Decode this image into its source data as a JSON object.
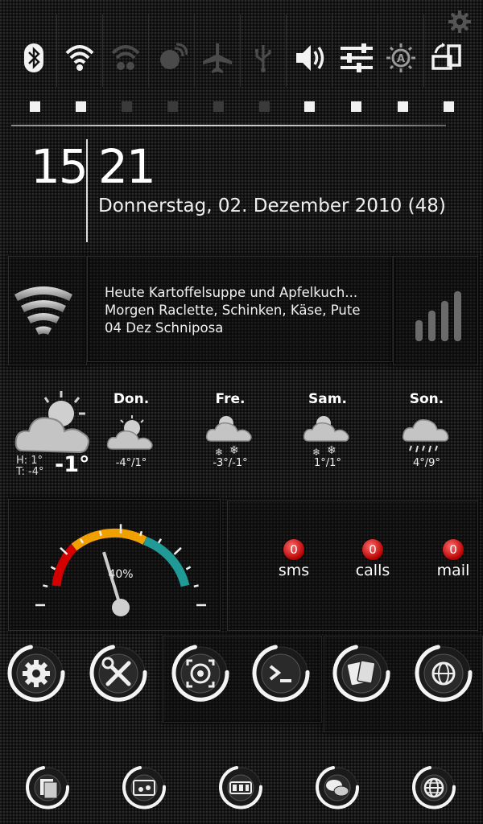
{
  "toggles": [
    {
      "name": "bluetooth",
      "icon": "bluetooth-icon",
      "on": true
    },
    {
      "name": "wifi",
      "icon": "wifi-icon",
      "on": true
    },
    {
      "name": "data",
      "icon": "mobile-data-icon",
      "on": false
    },
    {
      "name": "gps",
      "icon": "satellite-icon",
      "on": false
    },
    {
      "name": "airplane",
      "icon": "airplane-icon",
      "on": false
    },
    {
      "name": "usb",
      "icon": "usb-icon",
      "on": false
    },
    {
      "name": "sound",
      "icon": "volume-icon",
      "on": true
    },
    {
      "name": "settings",
      "icon": "sliders-icon",
      "on": true
    },
    {
      "name": "brightness",
      "icon": "brightness-auto-icon",
      "on": true
    },
    {
      "name": "rotate",
      "icon": "screen-rotate-icon",
      "on": true
    }
  ],
  "clock": {
    "hour": "15",
    "minute": "21",
    "date": "Donnerstag, 02. Dezember 2010 (48)"
  },
  "menu": {
    "lines": [
      "Heute Kartoffelsuppe und Apfelkuch...",
      "Morgen Raclette, Schinken, Käse, Pute",
      "04 Dez Schniposa"
    ]
  },
  "weather": {
    "today": {
      "hl": "H: 1°",
      "t": "T: -4°",
      "current": "-1°",
      "icon": "sun-cloud-icon"
    },
    "days": [
      {
        "name": "Don.",
        "temp": "-4°/1°",
        "icon": "partly-cloudy-icon"
      },
      {
        "name": "Fre.",
        "temp": "-3°/-1°",
        "icon": "snow-sun-icon"
      },
      {
        "name": "Sam.",
        "temp": "1°/1°",
        "icon": "snow-sun-icon"
      },
      {
        "name": "Son.",
        "temp": "4°/9°",
        "icon": "rain-icon"
      }
    ]
  },
  "battery": {
    "percent_label": "40%",
    "level": 0.4
  },
  "counters": [
    {
      "label": "sms",
      "count": "0"
    },
    {
      "label": "calls",
      "count": "0"
    },
    {
      "label": "mail",
      "count": "0"
    }
  ],
  "apps_row1": [
    {
      "icon": "settings-gear-icon"
    },
    {
      "icon": "tools-icon"
    },
    {
      "icon": "camera-icon"
    },
    {
      "icon": "terminal-icon"
    },
    {
      "icon": "cards-icon"
    },
    {
      "icon": "globe-icon"
    }
  ],
  "apps_row2": [
    {
      "icon": "files-icon"
    },
    {
      "icon": "music-icon"
    },
    {
      "icon": "calculator-icon"
    },
    {
      "icon": "chat-icon"
    },
    {
      "icon": "browser-globe-icon"
    }
  ],
  "colors": {
    "accent_red": "#d40000",
    "accent_orange": "#f0a000",
    "accent_teal": "#1f9a96",
    "badge": "#cc0000"
  }
}
